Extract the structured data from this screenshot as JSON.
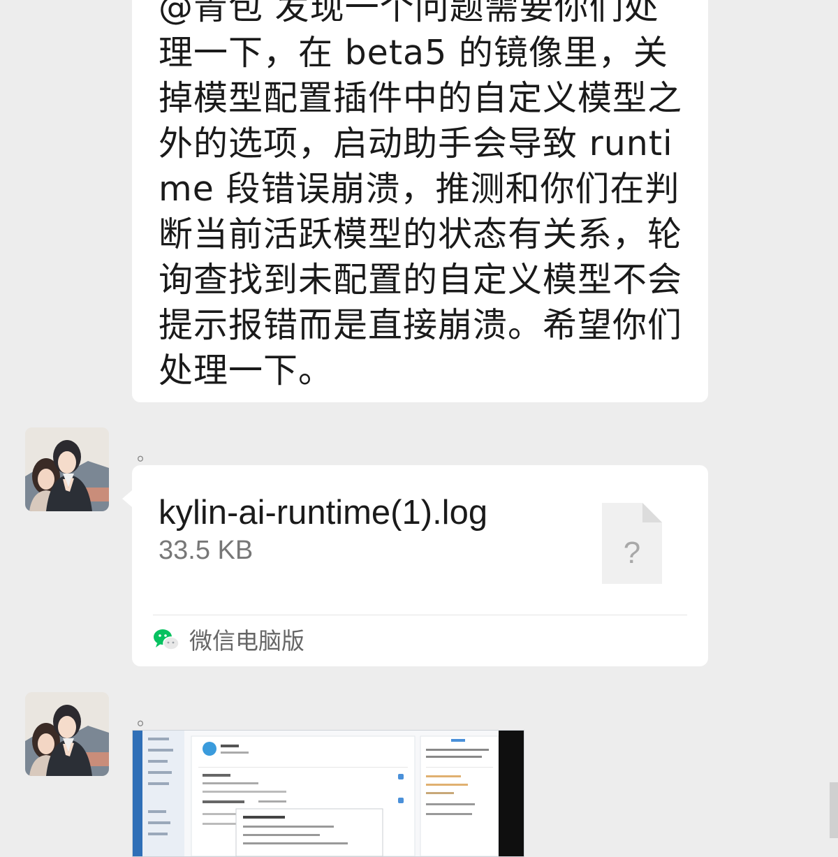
{
  "messages": {
    "text_message": {
      "content": "@青包  发现一个问题需要你们处理一下，在 beta5 的镜像里，关掉模型配置插件中的自定义模型之外的选项，启动助手会导致 runtime 段错误崩溃，推测和你们在判断当前活跃模型的状态有关系，轮询查找到未配置的自定义模型不会提示报错而是直接崩溃。希望你们处理一下。"
    },
    "file_message": {
      "sender_name": "。",
      "file_name": "kylin-ai-runtime(1).log",
      "file_size": "33.5 KB",
      "file_icon_glyph": "?",
      "source_label": "微信电脑版",
      "icon": "wechat-icon"
    },
    "image_message": {
      "sender_name": "。"
    }
  },
  "colors": {
    "background": "#ededed",
    "bubble": "#ffffff",
    "wechat_green": "#07c160"
  }
}
